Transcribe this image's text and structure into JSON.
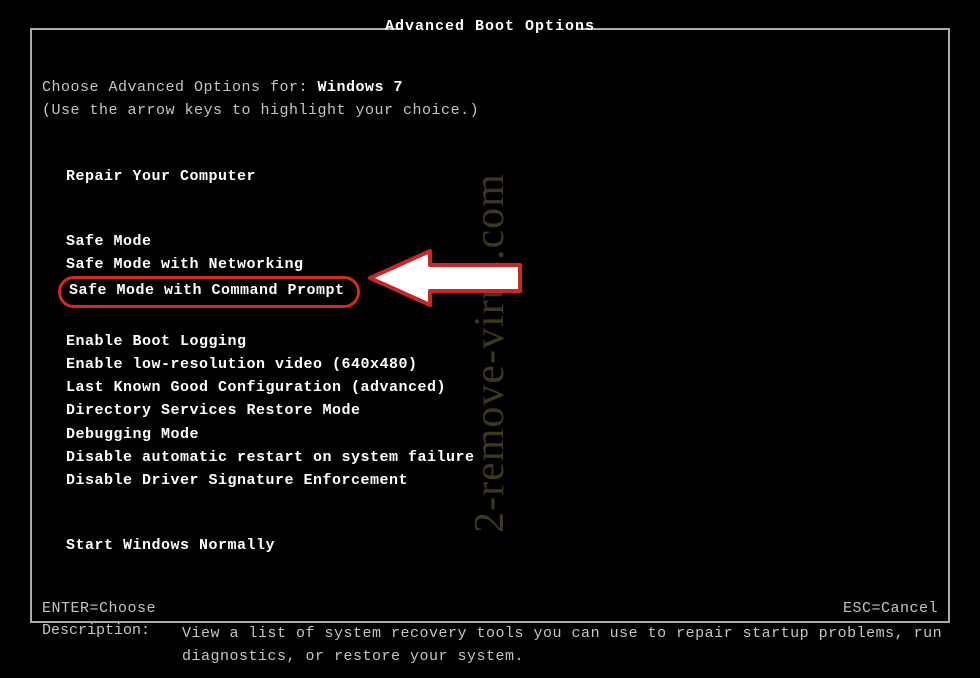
{
  "title": "Advanced Boot Options",
  "prompt_prefix": "Choose Advanced Options for: ",
  "os_name": "Windows 7",
  "hint": "(Use the arrow keys to highlight your choice.)",
  "groups": {
    "repair": "Repair Your Computer",
    "safe": [
      "Safe Mode",
      "Safe Mode with Networking",
      "Safe Mode with Command Prompt"
    ],
    "advanced": [
      "Enable Boot Logging",
      "Enable low-resolution video (640x480)",
      "Last Known Good Configuration (advanced)",
      "Directory Services Restore Mode",
      "Debugging Mode",
      "Disable automatic restart on system failure",
      "Disable Driver Signature Enforcement"
    ],
    "normal": "Start Windows Normally"
  },
  "description_label": "Description:",
  "description_text": "View a list of system recovery tools you can use to repair startup problems, run diagnostics, or restore your system.",
  "footer": {
    "enter": "ENTER=Choose",
    "esc": "ESC=Cancel"
  },
  "watermark": "2-remove-virus.com",
  "highlighted_index": 2
}
